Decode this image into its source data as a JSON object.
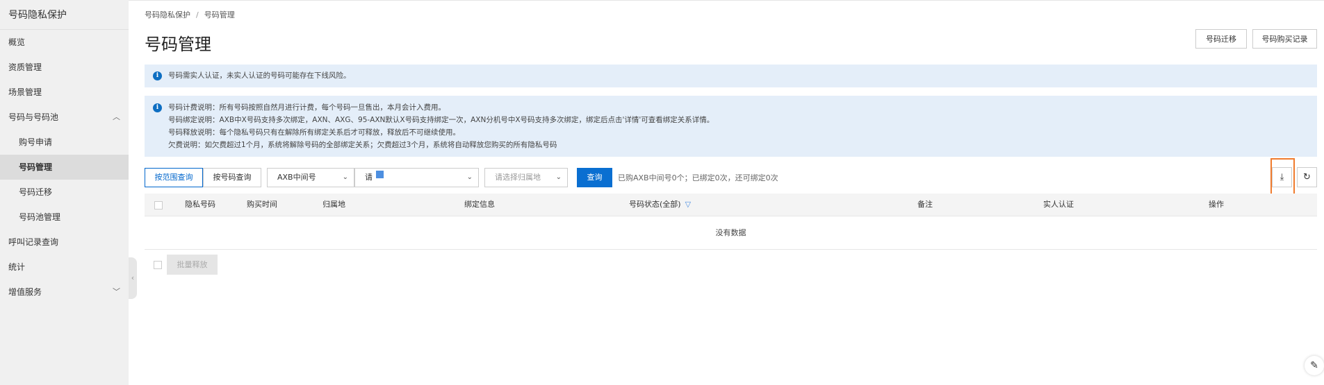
{
  "sidebar": {
    "title": "号码隐私保护",
    "items": [
      {
        "label": "概览"
      },
      {
        "label": "资质管理"
      },
      {
        "label": "场景管理"
      },
      {
        "label": "号码与号码池",
        "chevron": "chevron-up-icon"
      },
      {
        "label": "购号申请"
      },
      {
        "label": "号码管理"
      },
      {
        "label": "号码迁移"
      },
      {
        "label": "号码池管理"
      },
      {
        "label": "呼叫记录查询"
      },
      {
        "label": "统计"
      },
      {
        "label": "增值服务",
        "chevron": "chevron-down-icon"
      }
    ]
  },
  "breadcrumb": {
    "root": "号码隐私保护",
    "separator": "/",
    "current": "号码管理"
  },
  "page": {
    "title": "号码管理"
  },
  "header_buttons": {
    "migrate": "号码迁移",
    "purchase_records": "号码购买记录"
  },
  "notices": {
    "warning": "号码需实人认证，未实人认证的号码可能存在下线风险。",
    "info_lines": [
      "号码计费说明：所有号码按照自然月进行计费，每个号码一旦售出，本月会计入费用。",
      "号码绑定说明：AXB中X号码支持多次绑定，AXN、AXG、95-AXN默认X号码支持绑定一次，AXN分机号中X号码支持多次绑定，绑定后点击'详情'可查看绑定关系详情。",
      "号码释放说明：每个隐私号码只有在解除所有绑定关系后才可释放，释放后不可继续使用。",
      "欠费说明：如欠费超过1个月，系统将解除号码的全部绑定关系；欠费超过3个月，系统将自动释放您购买的所有隐私号码"
    ]
  },
  "toolbar": {
    "tab_range": "按范围查询",
    "tab_number": "按号码查询",
    "type_select": "AXB中间号",
    "pool_select": "请",
    "region_placeholder": "请选择归属地",
    "query": "查询",
    "info": "已购AXB中间号0个；已绑定0次，还可绑定0次"
  },
  "table": {
    "columns": [
      "隐私号码",
      "购买时间",
      "归属地",
      "绑定信息",
      "号码状态(全部)",
      "备注",
      "实人认证",
      "操作"
    ],
    "empty_text": "没有数据"
  },
  "footer": {
    "batch_release": "批量释放"
  },
  "colors": {
    "primary": "#0a6fd1",
    "notice_bg": "#e4eef9",
    "highlight": "#f07b2d"
  }
}
